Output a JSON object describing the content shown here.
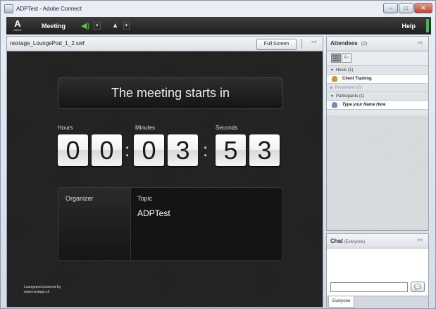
{
  "window": {
    "title": "ADPTest - Adobe Connect",
    "minimize": "–",
    "maximize": "□",
    "close": "✕"
  },
  "menubar": {
    "logo_mark": "A",
    "logo_word": "Adobe",
    "meeting": "Meeting",
    "speaker_glyph": "◀)",
    "camera_glyph": "▲",
    "dropdown_glyph": "▾",
    "help": "Help"
  },
  "share_pod": {
    "title": "nextage_LoungePod_1_2.swf",
    "fullscreen_label": "Full Screen",
    "menu_glyph": "≡▾",
    "banner": "The meeting starts in",
    "labels": {
      "hours": "Hours",
      "minutes": "Minutes",
      "seconds": "Seconds"
    },
    "digits": [
      "0",
      "0",
      "0",
      "3",
      "5",
      "3"
    ],
    "colon": ":",
    "organizer_label": "Organizer",
    "topic_label": "Topic",
    "topic_value": "ADPTest",
    "powered_line1": "Loungepod powered by",
    "powered_line2": "www.nextage.ch"
  },
  "attendees": {
    "title": "Attendees",
    "count": "(2)",
    "menu_glyph": "≡▾",
    "sort_glyph": "A↕",
    "hosts_label": "Hosts (1)",
    "host_name": "Client Training",
    "presenters_label": "Presenters (0)",
    "participants_label": "Participants (1)",
    "participant_name": "Type your Name Here",
    "expanded_glyph": "▼",
    "collapsed_glyph": "▶"
  },
  "chat": {
    "title": "Chat",
    "scope": "(Everyone)",
    "menu_glyph": "≡▾",
    "input_value": "",
    "send_glyph": "💬",
    "tab": "Everyone"
  },
  "colors": {
    "accent_green": "#3cbf3c",
    "stage": "#1e1e1e",
    "host_icon": "#c89a2a",
    "participant_icon": "#6b8fbf"
  }
}
